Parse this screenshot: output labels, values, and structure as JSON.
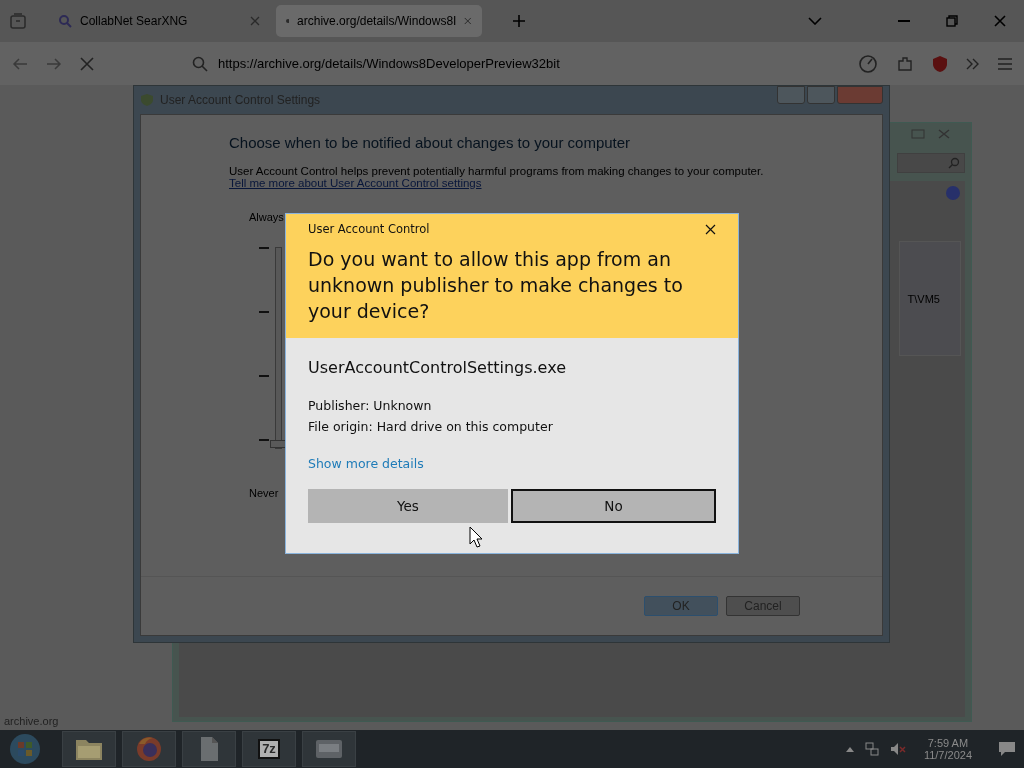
{
  "browser": {
    "tabs": [
      {
        "title": "CollabNet SearXNG",
        "selected": false
      },
      {
        "title": "archive.org/details/Windows8I",
        "selected": true
      }
    ],
    "address": "https://archive.org/details/Windows8DeveloperPreview32bit",
    "status_text": "archive.org"
  },
  "settings_window": {
    "title": "User Account Control Settings",
    "heading": "Choose when to be notified about changes to your computer",
    "description": "User Account Control helps prevent potentially harmful programs from making changes to your computer.",
    "link": "Tell me more about User Account Control settings",
    "top_label": "Always",
    "bottom_label": "Never",
    "slider": {
      "level": 0
    },
    "buttons": [
      {
        "label": "OK",
        "selected": true
      },
      {
        "label": "Cancel",
        "selected": false
      }
    ]
  },
  "back_window": {
    "fragment": "T\\VM5"
  },
  "dialog": {
    "title": "User Account Control",
    "question": "Do you want to allow this app from an unknown publisher to make changes to your device?",
    "app_name": "UserAccountControlSettings.exe",
    "details": [
      "Publisher: Unknown",
      "File origin: Hard drive on this computer"
    ],
    "link": "Show more details",
    "buttons": [
      {
        "label": "Yes",
        "selected": false
      },
      {
        "label": "No",
        "selected": true
      }
    ]
  },
  "taskbar": {
    "apps": [
      {
        "kind": "folder"
      },
      {
        "kind": "browser"
      },
      {
        "kind": "document"
      },
      {
        "kind": "archiver",
        "label": "7z"
      },
      {
        "kind": "window"
      }
    ],
    "time": "7:59 AM",
    "date": "11/7/2024"
  }
}
